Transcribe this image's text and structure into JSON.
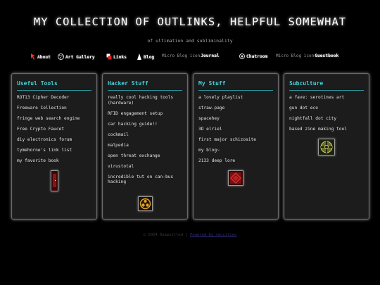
{
  "header": {
    "title": "MY COLLECTION OF OUTLINKS, HELPFUL SOMEWHAT",
    "subtitle": "of ultimation and subliminality"
  },
  "nav": {
    "about": "About",
    "art_gallery": "Art Gallery",
    "links": "Links",
    "blog": "Blog",
    "journal_alt": "Micro Blog icon",
    "journal": "Journal",
    "chatroom": "Chatroom",
    "guestbook_alt": "Micro Blog icon",
    "guestbook": "Guestbook"
  },
  "panels": {
    "useful_tools": {
      "title": "Useful Tools",
      "items": [
        "ROT13 Cipher Decoder",
        "Freeware Collection",
        "fringe web search engine",
        "Free Crypto Faucet",
        "diy electronics forum",
        "tymehorne's link list",
        "my favorite book"
      ]
    },
    "hacker_stuff": {
      "title": "Hacker Stuff",
      "items": [
        "really cool hacking tools (hardware)",
        "RFID engagement setup",
        "car hacking guide!!",
        "cockmail",
        "malpedia",
        "open threat exchange",
        "virustotal",
        "incredible tut on can-bus hacking"
      ]
    },
    "my_stuff": {
      "title": "My Stuff",
      "items": [
        "a lovely playlist",
        "straw.page",
        "spacehey",
        "3D elriel",
        "first major schizosite",
        "my blog~",
        "2133 deep lore"
      ]
    },
    "subculture": {
      "title": "Subculture",
      "items": [
        "a fave: serotines art",
        "gun dot eco",
        "nightfall dot city",
        "based zine making tool"
      ]
    }
  },
  "footer": {
    "copyright": "© 2024 Dumpsilled |",
    "link": "Powered by neocities"
  },
  "colors": {
    "background": "#000000",
    "panel_bg": "#1c1c1c",
    "panel_title": "#3fd0d8",
    "rule": "#2a8f97"
  }
}
